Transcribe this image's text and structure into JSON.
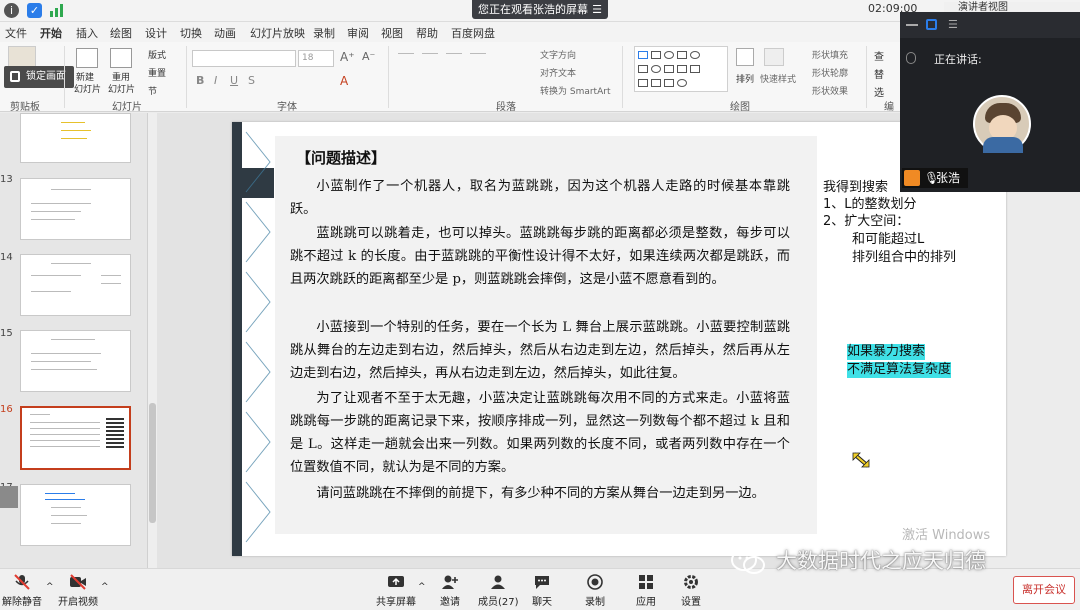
{
  "system": {
    "viewing_banner": "您正在观看张浩的屏幕",
    "clock": "02:09:00",
    "present_view": "演讲者视图"
  },
  "ribbon": {
    "tabs": [
      "文件",
      "开始",
      "插入",
      "绘图",
      "设计",
      "切换",
      "动画",
      "幻灯片放映",
      "录制",
      "审阅",
      "视图",
      "帮助",
      "百度网盘"
    ],
    "active_tab": "开始",
    "lock_screen": "锁定画面",
    "groups": {
      "clipboard": "剪贴板",
      "slides": "幻灯片",
      "font": "字体",
      "paragraph": "段落",
      "drawing": "绘图",
      "edit": "编"
    },
    "new_slide": "新建",
    "new_slide2": "幻灯片",
    "reuse": "重用",
    "reuse2": "幻灯片",
    "layout": "版式",
    "reset": "重置",
    "section": "节",
    "font_size": "18",
    "text_direction": "文字方向",
    "align_text": "对齐文本",
    "smartart": "转换为 SmartArt",
    "arrange": "排列",
    "quick_styles": "快速样式",
    "shape_fill": "形状填充",
    "shape_outline": "形状轮廓",
    "shape_effects": "形状效果",
    "find": "查",
    "replace": "替",
    "select": "选"
  },
  "thumbnails": [
    {
      "number": "13"
    },
    {
      "number": "14"
    },
    {
      "number": "15"
    },
    {
      "number": "16"
    },
    {
      "number": "17"
    }
  ],
  "slide": {
    "title": "【问题描述】",
    "paragraphs": [
      "小蓝制作了一个机器人，取名为蓝跳跳，因为这个机器人走路的时候基本靠跳跃。",
      "蓝跳跳可以跳着走，也可以掉头。蓝跳跳每步跳的距离都必须是整数，每步可以跳不超过 k 的长度。由于蓝跳跳的平衡性设计得不太好，如果连续两次都是跳跃，而且两次跳跃的距离都至少是 p，则蓝跳跳会摔倒，这是小蓝不愿意看到的。",
      "小蓝接到一个特别的任务，要在一个长为 L 舞台上展示蓝跳跳。小蓝要控制蓝跳跳从舞台的左边走到右边，然后掉头，然后从右边走到左边，然后掉头，然后再从左边走到右边，然后掉头，再从右边走到左边，然后掉头，如此往复。",
      "为了让观者不至于太无趣，小蓝决定让蓝跳跳每次用不同的方式来走。小蓝将蓝跳跳每一步跳的距离记录下来，按顺序排成一列，显然这一列数每个都不超过 k 且和是 L。这样走一趟就会出来一列数。如果两列数的长度不同，或者两列数中存在一个位置数值不同，就认为是不同的方案。",
      "请问蓝跳跳在不摔倒的前提下，有多少种不同的方案从舞台一边走到另一边。"
    ],
    "notes": {
      "line1": "我得到搜索",
      "line2": "1、L的整数划分",
      "line3": "2、扩大空间：",
      "line4": "和可能超过L",
      "line5": "排列组合中的排列",
      "highlight1": "如果暴力搜索",
      "highlight2": "不满足算法复杂度"
    }
  },
  "video": {
    "speaking_label": "正在讲话:",
    "speaker_name": "张浩"
  },
  "activate_windows": "激活 Windows",
  "toolbar": {
    "unmute": "解除静音",
    "start_video": "开启视频",
    "share_screen": "共享屏幕",
    "invite": "邀请",
    "members": "成员(27)",
    "chat": "聊天",
    "record": "录制",
    "apps": "应用",
    "settings": "设置",
    "leave": "离开会议"
  },
  "watermark": "大数据时代之应天归德",
  "colors": {
    "accent": "#c43e1c",
    "highlight": "#3fe0e6",
    "slide_band": "#2f3a43",
    "leave": "#c8302c"
  }
}
